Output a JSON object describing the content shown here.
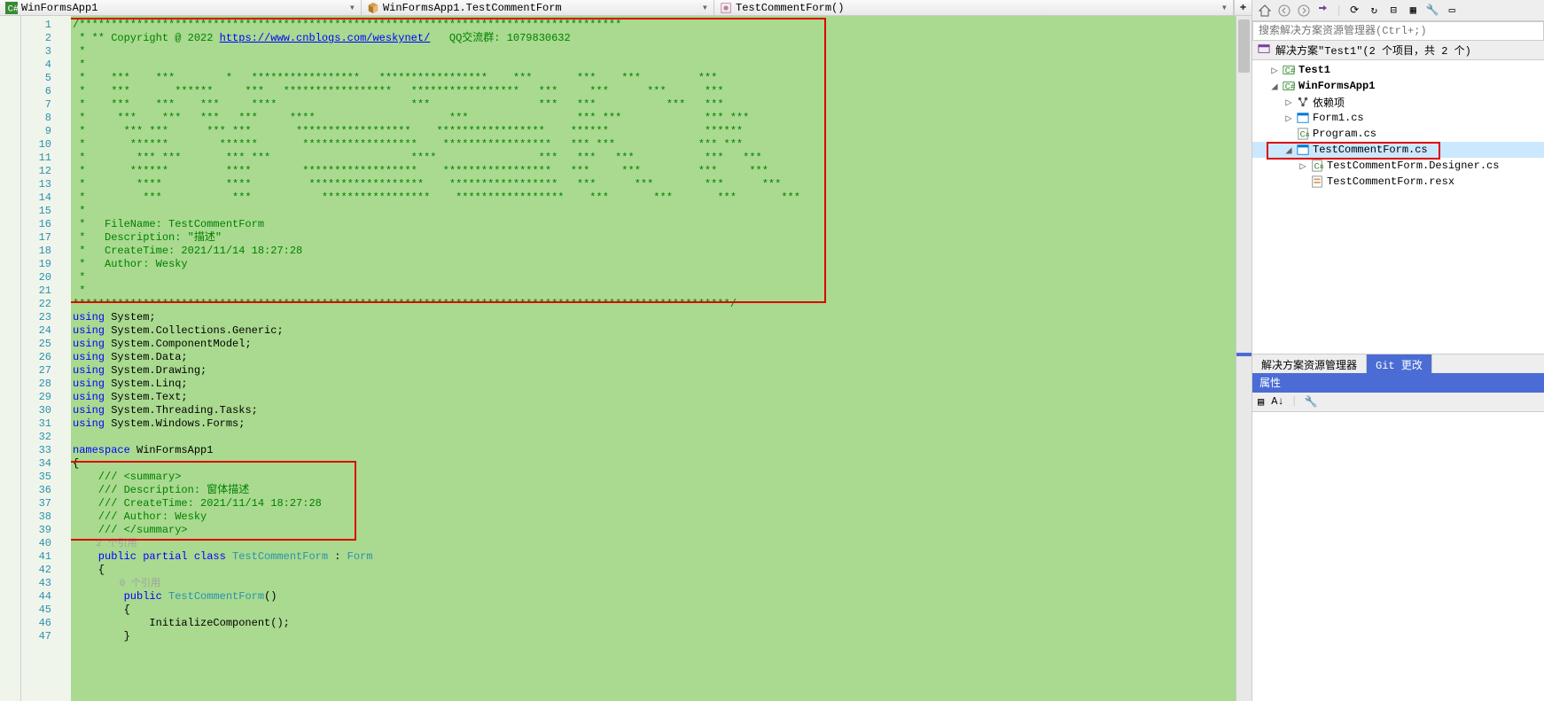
{
  "nav": {
    "scope": "WinFormsApp1",
    "class": "WinFormsApp1.TestCommentForm",
    "member": "TestCommentForm()"
  },
  "code": {
    "comment_head": "/*************************************************************************************",
    "copyright_prefix": " * ** Copyright @ 2022 ",
    "copyright_url": "https://www.cnblogs.com/weskynet/",
    "copyright_suffix": "   QQ交流群: 1079830632",
    "star_line": " *",
    "ascii_art": [
      " *    ***    ***        *   *****************   *****************    ***       ***    ***         ***",
      " *    ***       ******     ***   *****************   *****************   ***     ***      ***      ***",
      " *    ***    ***    ***     ****                     ***                 ***   ***           ***   ***",
      " *     ***    ***   ***   ***     ****                     ***                 *** ***             *** ***",
      " *      *** ***      *** ***       ******************    *****************    ******               ******",
      " *       ******        ******       ******************    *****************   *** ***             *** ***",
      " *        *** ***       *** ***                      ****                ***   ***   ***           ***   ***",
      " *       ******         ****        ******************    *****************   ***     ***         ***     ***",
      " *        ****          ****         ******************    *****************   ***      ***        ***      ***",
      " *         ***           ***           *****************    *****************    ***       ***       ***       ***"
    ],
    "filename_line": " *   FileName: TestCommentForm",
    "description_line": " *   Description: \"描述\"",
    "createtime_line": " *   CreateTime: 2021/11/14 18:27:28",
    "author_line": " *   Author: Wesky",
    "comment_tail": "*******************************************************************************************************/",
    "usings": {
      "kw": "using",
      "ns": [
        "System;",
        "System.Collections.Generic;",
        "System.ComponentModel;",
        "System.Data;",
        "System.Drawing;",
        "System.Linq;",
        "System.Text;",
        "System.Threading.Tasks;",
        "System.Windows.Forms;"
      ]
    },
    "ns_kw": "namespace",
    "ns_name": " WinFormsApp1",
    "brace_open": "{",
    "summary": {
      "open": "    /// <summary>",
      "desc": "    /// Description: 窗体描述",
      "time": "    /// CreateTime: 2021/11/14 18:27:28",
      "author": "    /// Author: Wesky",
      "close": "    /// </summary>"
    },
    "codelens1": "    2 个引用",
    "classline": {
      "prefix": "    public partial class ",
      "name": "TestCommentForm",
      "suffix": " : ",
      "base": "Form"
    },
    "brace2": "    {",
    "codelens2": "        0 个引用",
    "ctor_prefix": "        public ",
    "ctor_name": "TestCommentForm",
    "ctor_suffix": "()",
    "brace3": "        {",
    "init_call": "            InitializeComponent();",
    "brace3c": "        }"
  },
  "solution": {
    "search_placeholder": "搜索解决方案资源管理器(Ctrl+;)",
    "root": "解决方案\"Test1\"(2 个项目，共 2 个)",
    "items": [
      {
        "label": "Test1",
        "depth": 1,
        "icon": "csproj",
        "bold": true,
        "exp": "▷"
      },
      {
        "label": "WinFormsApp1",
        "depth": 1,
        "icon": "csproj",
        "bold": true,
        "exp": "◢"
      },
      {
        "label": "依赖项",
        "depth": 2,
        "icon": "deps",
        "exp": "▷"
      },
      {
        "label": "Form1.cs",
        "depth": 2,
        "icon": "form",
        "exp": "▷"
      },
      {
        "label": "Program.cs",
        "depth": 2,
        "icon": "cs",
        "exp": ""
      },
      {
        "label": "TestCommentForm.cs",
        "depth": 2,
        "icon": "form",
        "selected": true,
        "exp": "◢"
      },
      {
        "label": "TestCommentForm.Designer.cs",
        "depth": 3,
        "icon": "cs",
        "exp": "▷"
      },
      {
        "label": "TestCommentForm.resx",
        "depth": 3,
        "icon": "resx",
        "exp": ""
      }
    ]
  },
  "right_tabs": {
    "a": "解决方案资源管理器",
    "b": "Git 更改"
  },
  "properties_header": "属性"
}
